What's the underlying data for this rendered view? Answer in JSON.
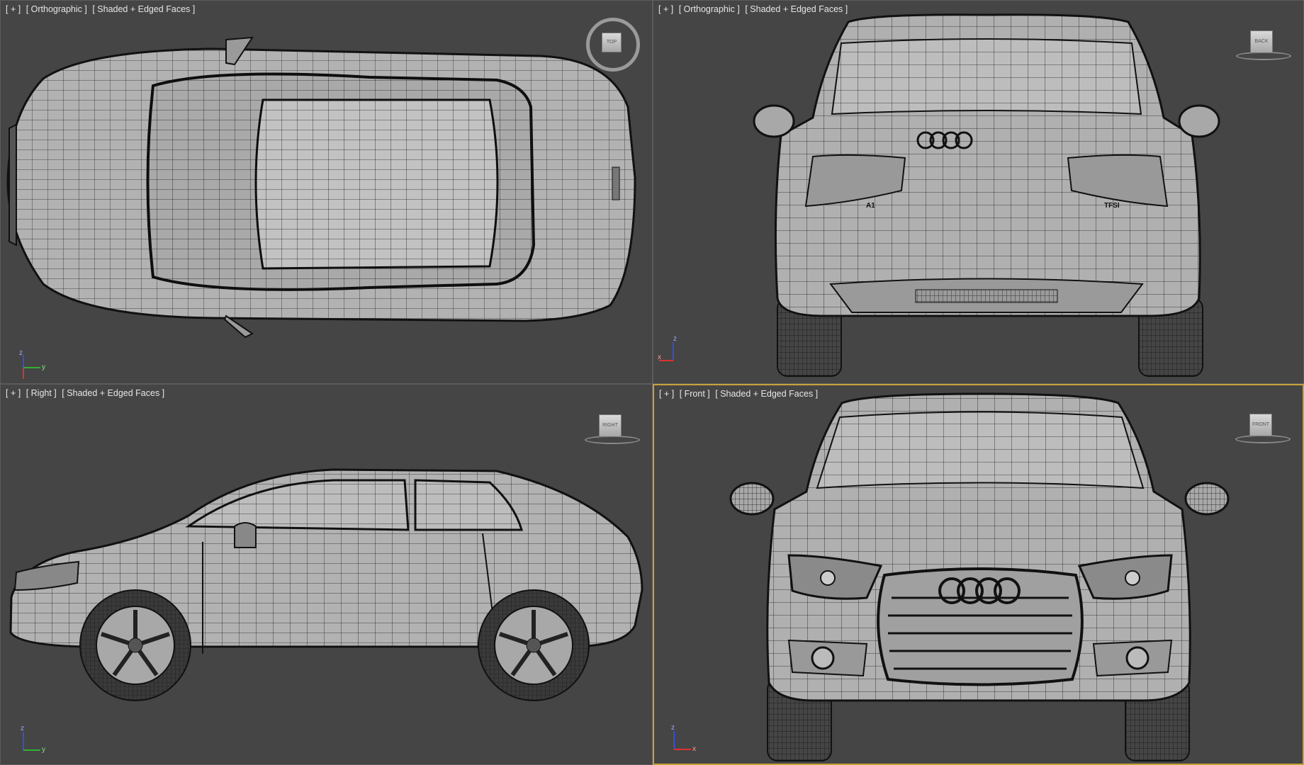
{
  "viewports": {
    "top": {
      "label_plus": "[ + ]",
      "label_view": "[ Orthographic ]",
      "label_shading": "[ Shaded + Edged Faces ]",
      "cube_text": "TOP"
    },
    "back": {
      "label_plus": "[ + ]",
      "label_view": "[ Orthographic ]",
      "label_shading": "[ Shaded + Edged Faces ]",
      "cube_text": "BACK",
      "badge_left": "A1",
      "badge_right": "TFSI"
    },
    "right": {
      "label_plus": "[ + ]",
      "label_view": "[ Right ]",
      "label_shading": "[ Shaded + Edged Faces ]",
      "cube_text": "RIGHT"
    },
    "front": {
      "label_plus": "[ + ]",
      "label_view": "[ Front ]",
      "label_shading": "[ Shaded + Edged Faces ]",
      "cube_text": "FRONT"
    }
  },
  "axis_labels": {
    "x": "x",
    "y": "y",
    "z": "z"
  },
  "colors": {
    "viewport_bg": "#454545",
    "active_border": "#c7a23a",
    "model_fill": "#b4b4b4",
    "wire": "#1a1a1a",
    "axis_x": "#e03030",
    "axis_y": "#30b030",
    "axis_z": "#3050e0"
  }
}
